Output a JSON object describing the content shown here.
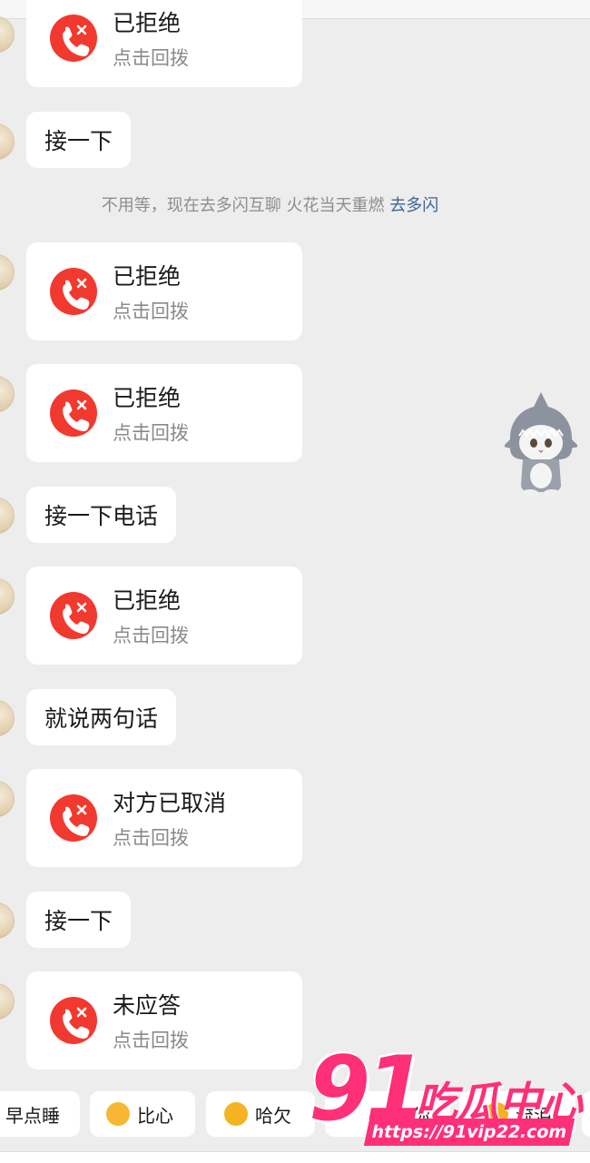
{
  "messages": [
    {
      "kind": "call",
      "title": "已拒绝",
      "sub": "点击回拨"
    },
    {
      "kind": "text",
      "text": "接一下"
    },
    {
      "kind": "call",
      "title": "已拒绝",
      "sub": "点击回拨"
    },
    {
      "kind": "call",
      "title": "已拒绝",
      "sub": "点击回拨"
    },
    {
      "kind": "text",
      "text": "接一下电话"
    },
    {
      "kind": "call",
      "title": "已拒绝",
      "sub": "点击回拨"
    },
    {
      "kind": "text",
      "text": "就说两句话"
    },
    {
      "kind": "call",
      "title": "对方已取消",
      "sub": "点击回拨"
    },
    {
      "kind": "text",
      "text": "接一下"
    },
    {
      "kind": "call",
      "title": "未应答",
      "sub": "点击回拨"
    }
  ],
  "system_note": {
    "text": "不用等，现在去多闪互聊 火花当天重燃",
    "link": "去多闪"
  },
  "quick_replies": [
    {
      "label": "早点睡",
      "emoji": ""
    },
    {
      "label": "比心",
      "emoji": "duck-heart"
    },
    {
      "label": "哈欠",
      "emoji": "yawn-face"
    },
    {
      "label": "抱抱你",
      "emoji": ""
    },
    {
      "label": "流泪",
      "emoji": "crying-face"
    }
  ],
  "watermark": {
    "number": "91",
    "name": "吃瓜中心",
    "url": "https://91vip22.com"
  },
  "colors": {
    "background": "#ededed",
    "bubble": "#ffffff",
    "missed_call_red": "#f2392f",
    "link_blue": "#3c6592",
    "watermark_pink": "#ff2f78"
  }
}
